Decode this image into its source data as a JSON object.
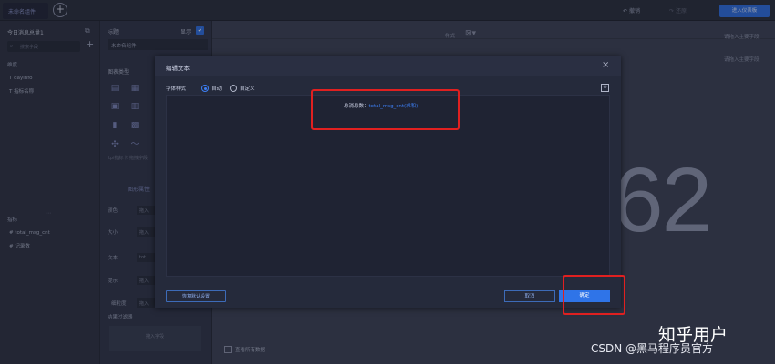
{
  "topbar": {
    "active_tab": "未命名组件",
    "add_tab_symbol": "+",
    "undo_label": "撤销",
    "redo_label": "还原",
    "action_button": "进入仪表板"
  },
  "left_panel": {
    "title": "今日消息总量1",
    "search_placeholder": "搜索字段",
    "dimension_heading": "维度",
    "dimensions": [
      "dayinfo",
      "指标名称"
    ],
    "measure_heading": "指标",
    "measures": [
      "total_msg_cnt",
      "记录数"
    ]
  },
  "mid_panel": {
    "title_label": "标题",
    "show_label": "显示",
    "chart_name": "未命名组件",
    "chart_type_label": "图表类型",
    "chart_hint": "kpi指标卡 拖拽字段",
    "attr_tab": "图形属性",
    "rows": [
      {
        "label": "颜色",
        "value": "拖入"
      },
      {
        "label": "大小",
        "value": "拖入"
      },
      {
        "label": "文本",
        "value": "tot"
      },
      {
        "label": "提示",
        "value": "拖入"
      },
      {
        "label": "细粒度",
        "value": "拖入"
      }
    ],
    "filter_label": "结果过滤器",
    "drop_field": "拖入字段"
  },
  "canvas": {
    "style_label": "样式",
    "drop_hint_1": "请拖入主要字段",
    "drop_hint_2": "请拖入主要字段",
    "big_value": "62",
    "view_all_label": "查看所有数据"
  },
  "modal": {
    "title": "编辑文本",
    "close_symbol": "×",
    "font_style_label": "字体样式",
    "option_auto": "自动",
    "option_custom": "自定义",
    "editor_prefix": "总消息数：",
    "editor_token": "total_msg_cnt(求和)",
    "reset_button": "恢复默认设置",
    "cancel_button": "取消",
    "ok_button": "确定"
  },
  "watermark": {
    "line1": "知乎用户",
    "line2": "CSDN @黑马程序员官方"
  }
}
